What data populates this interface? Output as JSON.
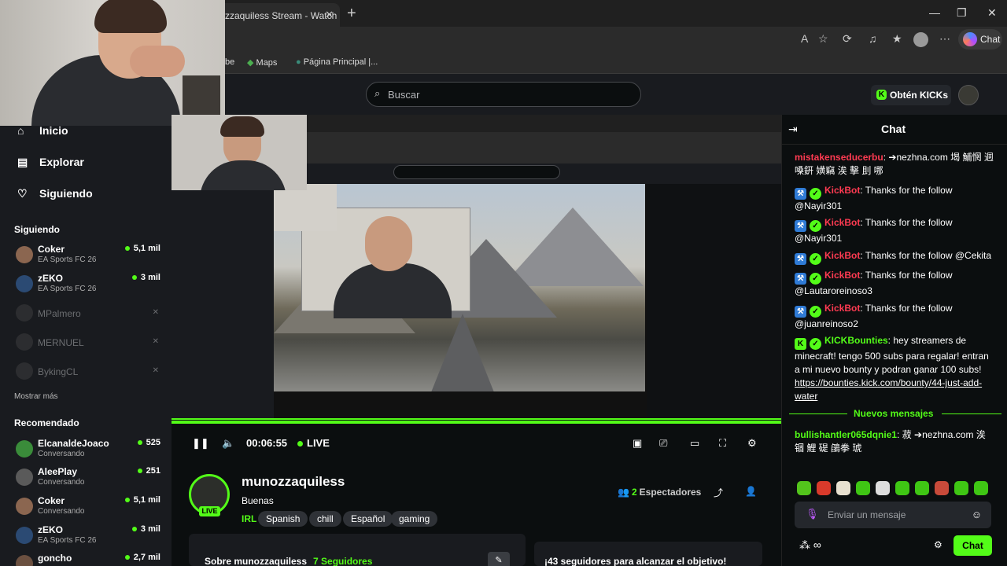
{
  "browser": {
    "tab_title": "zzaquiless Stream - Watch Li",
    "tab_close": "✕",
    "new_tab": "+",
    "window_controls": {
      "min": "—",
      "max": "❐",
      "close": "✕"
    },
    "toolbar_icons": [
      "A",
      "☆",
      "⟳",
      "♫",
      "★",
      "⋯"
    ],
    "copilot_label": "Chat",
    "favorites": [
      {
        "label": "be"
      },
      {
        "label": "Maps"
      },
      {
        "label": "Página Principal |..."
      }
    ]
  },
  "header": {
    "search_placeholder": "Buscar",
    "kicks_button": "Obtén KICKs"
  },
  "sidebar": {
    "nav": [
      {
        "label": "Inicio",
        "icon": "home-icon"
      },
      {
        "label": "Explorar",
        "icon": "explore-icon"
      },
      {
        "label": "Siguiendo",
        "icon": "heart-icon"
      }
    ],
    "following_title": "Siguiendo",
    "following": [
      {
        "name": "Coker",
        "sub": "EA Sports FC 26",
        "count": "5,1 mil",
        "live": true
      },
      {
        "name": "zEKO",
        "sub": "EA Sports FC 26",
        "count": "3 mil",
        "live": true
      },
      {
        "name": "MPalmero",
        "live": false
      },
      {
        "name": "MERNUEL",
        "live": false
      },
      {
        "name": "BykingCL",
        "live": false
      }
    ],
    "show_more": "Mostrar más",
    "recommended_title": "Recomendado",
    "recommended": [
      {
        "name": "ElcanaldeJoaco",
        "sub": "Conversando",
        "count": "525"
      },
      {
        "name": "AleePlay",
        "sub": "Conversando",
        "count": "251"
      },
      {
        "name": "Coker",
        "sub": "Conversando",
        "count": "5,1 mil"
      },
      {
        "name": "zEKO",
        "sub": "EA Sports FC 26",
        "count": "3 mil"
      },
      {
        "name": "goncho",
        "sub": "",
        "count": "2,7 mil"
      }
    ]
  },
  "player": {
    "time": "00:06:55",
    "live_label": "LIVE",
    "progress_pct": 100
  },
  "stream": {
    "streamer": "munozzaquiless",
    "title": "Buenas",
    "category": "IRL",
    "tags": [
      "Spanish",
      "chill",
      "Español",
      "gaming"
    ],
    "viewers": "2",
    "viewers_label": "Espectadores",
    "live_badge": "LIVE",
    "about": "Sobre munozzaquiless",
    "followers": "7 Seguidores",
    "goal": "¡43 seguidores para alcanzar el objetivo!"
  },
  "chat": {
    "title": "Chat",
    "messages": [
      {
        "user": "mistakenseducerbu",
        "text": ": ➔nezhna.com 堨 鯆惘 迵 嗓銒 嫹竊 涘 擊 刞 哪"
      },
      {
        "user": "KickBot",
        "text": ": Thanks for the follow @Nayir301"
      },
      {
        "user": "KickBot",
        "text": ": Thanks for the follow @Nayir301"
      },
      {
        "user": "KickBot",
        "text": ": Thanks for the follow @Cekita"
      },
      {
        "user": "KickBot",
        "text": ": Thanks for the follow @Lautaroreinoso3"
      },
      {
        "user": "KickBot",
        "text": ": Thanks for the follow @juanreinoso2"
      },
      {
        "user": "KICKBounties",
        "text": ": hey streamers de minecraft! tengo 500 subs para regalar! entran a mi nuevo bounty y podran ganar 100 subs! ",
        "link": "https://bounties.kick.com/bounty/44-just-add-water"
      }
    ],
    "new_messages": "Nuevos mensajes",
    "after": [
      {
        "user": "bullishantler065dqnie1",
        "text": ": 菽 ➔nezhna.com 涘 锢 鯉 碮 鵮拳 琥"
      }
    ],
    "input_placeholder": "Enviar un mensaje",
    "points": "∞",
    "send_label": "Chat"
  },
  "colors": {
    "kick_green": "#53fc18",
    "bot_red": "#ff3b52"
  }
}
